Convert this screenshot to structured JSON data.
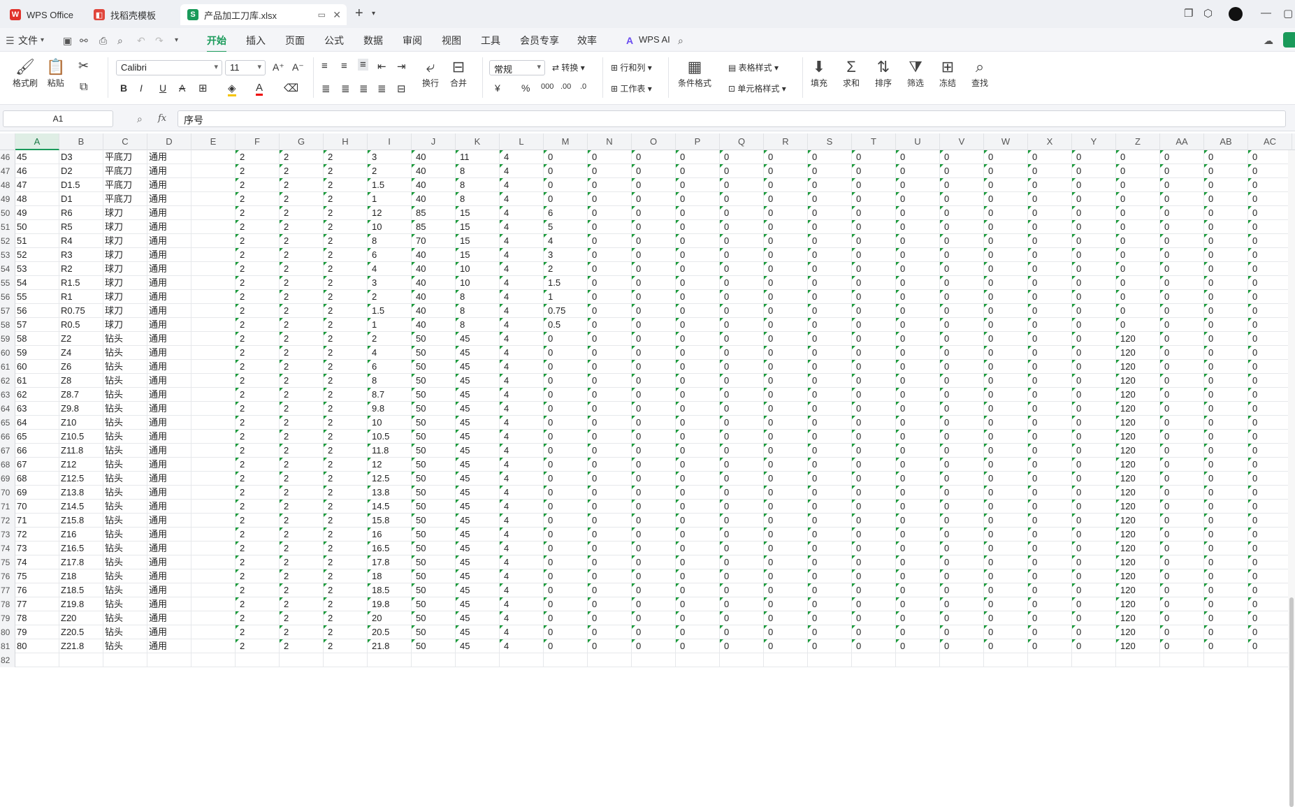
{
  "tabs": {
    "wps": "WPS Office",
    "template": "找稻壳模板",
    "file": "产品加工刀库.xlsx"
  },
  "menu": {
    "file": "文件",
    "items": [
      "开始",
      "插入",
      "页面",
      "公式",
      "数据",
      "审阅",
      "视图",
      "工具",
      "会员专享",
      "效率"
    ],
    "wpsai": "WPS AI"
  },
  "ribbon": {
    "format_painter": "格式刷",
    "paste": "粘贴",
    "font": "Calibri",
    "size": "11",
    "wrap": "换行",
    "merge": "合并",
    "numfmt": "常规",
    "convert": "转换",
    "rowcol": "行和列",
    "sheet": "工作表",
    "condfmt": "条件格式",
    "tablestyle": "表格样式",
    "cellstyle": "单元格样式",
    "fill": "填充",
    "sum": "求和",
    "sort": "排序",
    "filter": "筛选",
    "freeze": "冻结",
    "find": "查找"
  },
  "formula_bar": {
    "cell_ref": "A1",
    "fx": "fx",
    "content": "序号"
  },
  "columns": [
    "A",
    "B",
    "C",
    "D",
    "E",
    "F",
    "G",
    "H",
    "I",
    "J",
    "K",
    "L",
    "M",
    "N",
    "O",
    "P",
    "Q",
    "R",
    "S",
    "T",
    "U",
    "V",
    "W",
    "X",
    "Y",
    "Z",
    "AA",
    "AB",
    "AC"
  ],
  "rows": [
    {
      "r": "46",
      "c": [
        "45",
        "D3",
        "平底刀",
        "通用",
        "",
        "2",
        "2",
        "2",
        "3",
        "40",
        "11",
        "4",
        "0",
        "0",
        "0",
        "0",
        "0",
        "0",
        "0",
        "0",
        "0",
        "0",
        "0",
        "0",
        "0",
        "0",
        "0",
        "0",
        "0"
      ]
    },
    {
      "r": "47",
      "c": [
        "46",
        "D2",
        "平底刀",
        "通用",
        "",
        "2",
        "2",
        "2",
        "2",
        "40",
        "8",
        "4",
        "0",
        "0",
        "0",
        "0",
        "0",
        "0",
        "0",
        "0",
        "0",
        "0",
        "0",
        "0",
        "0",
        "0",
        "0",
        "0",
        "0"
      ]
    },
    {
      "r": "48",
      "c": [
        "47",
        "D1.5",
        "平底刀",
        "通用",
        "",
        "2",
        "2",
        "2",
        "1.5",
        "40",
        "8",
        "4",
        "0",
        "0",
        "0",
        "0",
        "0",
        "0",
        "0",
        "0",
        "0",
        "0",
        "0",
        "0",
        "0",
        "0",
        "0",
        "0",
        "0"
      ]
    },
    {
      "r": "49",
      "c": [
        "48",
        "D1",
        "平底刀",
        "通用",
        "",
        "2",
        "2",
        "2",
        "1",
        "40",
        "8",
        "4",
        "0",
        "0",
        "0",
        "0",
        "0",
        "0",
        "0",
        "0",
        "0",
        "0",
        "0",
        "0",
        "0",
        "0",
        "0",
        "0",
        "0"
      ]
    },
    {
      "r": "50",
      "c": [
        "49",
        "R6",
        "球刀",
        "通用",
        "",
        "2",
        "2",
        "2",
        "12",
        "85",
        "15",
        "4",
        "6",
        "0",
        "0",
        "0",
        "0",
        "0",
        "0",
        "0",
        "0",
        "0",
        "0",
        "0",
        "0",
        "0",
        "0",
        "0",
        "0"
      ]
    },
    {
      "r": "51",
      "c": [
        "50",
        "R5",
        "球刀",
        "通用",
        "",
        "2",
        "2",
        "2",
        "10",
        "85",
        "15",
        "4",
        "5",
        "0",
        "0",
        "0",
        "0",
        "0",
        "0",
        "0",
        "0",
        "0",
        "0",
        "0",
        "0",
        "0",
        "0",
        "0",
        "0"
      ]
    },
    {
      "r": "52",
      "c": [
        "51",
        "R4",
        "球刀",
        "通用",
        "",
        "2",
        "2",
        "2",
        "8",
        "70",
        "15",
        "4",
        "4",
        "0",
        "0",
        "0",
        "0",
        "0",
        "0",
        "0",
        "0",
        "0",
        "0",
        "0",
        "0",
        "0",
        "0",
        "0",
        "0"
      ]
    },
    {
      "r": "53",
      "c": [
        "52",
        "R3",
        "球刀",
        "通用",
        "",
        "2",
        "2",
        "2",
        "6",
        "40",
        "15",
        "4",
        "3",
        "0",
        "0",
        "0",
        "0",
        "0",
        "0",
        "0",
        "0",
        "0",
        "0",
        "0",
        "0",
        "0",
        "0",
        "0",
        "0"
      ]
    },
    {
      "r": "54",
      "c": [
        "53",
        "R2",
        "球刀",
        "通用",
        "",
        "2",
        "2",
        "2",
        "4",
        "40",
        "10",
        "4",
        "2",
        "0",
        "0",
        "0",
        "0",
        "0",
        "0",
        "0",
        "0",
        "0",
        "0",
        "0",
        "0",
        "0",
        "0",
        "0",
        "0"
      ]
    },
    {
      "r": "55",
      "c": [
        "54",
        "R1.5",
        "球刀",
        "通用",
        "",
        "2",
        "2",
        "2",
        "3",
        "40",
        "10",
        "4",
        "1.5",
        "0",
        "0",
        "0",
        "0",
        "0",
        "0",
        "0",
        "0",
        "0",
        "0",
        "0",
        "0",
        "0",
        "0",
        "0",
        "0"
      ]
    },
    {
      "r": "56",
      "c": [
        "55",
        "R1",
        "球刀",
        "通用",
        "",
        "2",
        "2",
        "2",
        "2",
        "40",
        "8",
        "4",
        "1",
        "0",
        "0",
        "0",
        "0",
        "0",
        "0",
        "0",
        "0",
        "0",
        "0",
        "0",
        "0",
        "0",
        "0",
        "0",
        "0"
      ]
    },
    {
      "r": "57",
      "c": [
        "56",
        "R0.75",
        "球刀",
        "通用",
        "",
        "2",
        "2",
        "2",
        "1.5",
        "40",
        "8",
        "4",
        "0.75",
        "0",
        "0",
        "0",
        "0",
        "0",
        "0",
        "0",
        "0",
        "0",
        "0",
        "0",
        "0",
        "0",
        "0",
        "0",
        "0"
      ]
    },
    {
      "r": "58",
      "c": [
        "57",
        "R0.5",
        "球刀",
        "通用",
        "",
        "2",
        "2",
        "2",
        "1",
        "40",
        "8",
        "4",
        "0.5",
        "0",
        "0",
        "0",
        "0",
        "0",
        "0",
        "0",
        "0",
        "0",
        "0",
        "0",
        "0",
        "0",
        "0",
        "0",
        "0"
      ]
    },
    {
      "r": "59",
      "c": [
        "58",
        "Z2",
        "钻头",
        "通用",
        "",
        "2",
        "2",
        "2",
        "2",
        "50",
        "45",
        "4",
        "0",
        "0",
        "0",
        "0",
        "0",
        "0",
        "0",
        "0",
        "0",
        "0",
        "0",
        "0",
        "0",
        "120",
        "0",
        "0",
        "0"
      ]
    },
    {
      "r": "60",
      "c": [
        "59",
        "Z4",
        "钻头",
        "通用",
        "",
        "2",
        "2",
        "2",
        "4",
        "50",
        "45",
        "4",
        "0",
        "0",
        "0",
        "0",
        "0",
        "0",
        "0",
        "0",
        "0",
        "0",
        "0",
        "0",
        "0",
        "120",
        "0",
        "0",
        "0"
      ]
    },
    {
      "r": "61",
      "c": [
        "60",
        "Z6",
        "钻头",
        "通用",
        "",
        "2",
        "2",
        "2",
        "6",
        "50",
        "45",
        "4",
        "0",
        "0",
        "0",
        "0",
        "0",
        "0",
        "0",
        "0",
        "0",
        "0",
        "0",
        "0",
        "0",
        "120",
        "0",
        "0",
        "0"
      ]
    },
    {
      "r": "62",
      "c": [
        "61",
        "Z8",
        "钻头",
        "通用",
        "",
        "2",
        "2",
        "2",
        "8",
        "50",
        "45",
        "4",
        "0",
        "0",
        "0",
        "0",
        "0",
        "0",
        "0",
        "0",
        "0",
        "0",
        "0",
        "0",
        "0",
        "120",
        "0",
        "0",
        "0"
      ]
    },
    {
      "r": "63",
      "c": [
        "62",
        "Z8.7",
        "钻头",
        "通用",
        "",
        "2",
        "2",
        "2",
        "8.7",
        "50",
        "45",
        "4",
        "0",
        "0",
        "0",
        "0",
        "0",
        "0",
        "0",
        "0",
        "0",
        "0",
        "0",
        "0",
        "0",
        "120",
        "0",
        "0",
        "0"
      ]
    },
    {
      "r": "64",
      "c": [
        "63",
        "Z9.8",
        "钻头",
        "通用",
        "",
        "2",
        "2",
        "2",
        "9.8",
        "50",
        "45",
        "4",
        "0",
        "0",
        "0",
        "0",
        "0",
        "0",
        "0",
        "0",
        "0",
        "0",
        "0",
        "0",
        "0",
        "120",
        "0",
        "0",
        "0"
      ]
    },
    {
      "r": "65",
      "c": [
        "64",
        "Z10",
        "钻头",
        "通用",
        "",
        "2",
        "2",
        "2",
        "10",
        "50",
        "45",
        "4",
        "0",
        "0",
        "0",
        "0",
        "0",
        "0",
        "0",
        "0",
        "0",
        "0",
        "0",
        "0",
        "0",
        "120",
        "0",
        "0",
        "0"
      ]
    },
    {
      "r": "66",
      "c": [
        "65",
        "Z10.5",
        "钻头",
        "通用",
        "",
        "2",
        "2",
        "2",
        "10.5",
        "50",
        "45",
        "4",
        "0",
        "0",
        "0",
        "0",
        "0",
        "0",
        "0",
        "0",
        "0",
        "0",
        "0",
        "0",
        "0",
        "120",
        "0",
        "0",
        "0"
      ]
    },
    {
      "r": "67",
      "c": [
        "66",
        "Z11.8",
        "钻头",
        "通用",
        "",
        "2",
        "2",
        "2",
        "11.8",
        "50",
        "45",
        "4",
        "0",
        "0",
        "0",
        "0",
        "0",
        "0",
        "0",
        "0",
        "0",
        "0",
        "0",
        "0",
        "0",
        "120",
        "0",
        "0",
        "0"
      ]
    },
    {
      "r": "68",
      "c": [
        "67",
        "Z12",
        "钻头",
        "通用",
        "",
        "2",
        "2",
        "2",
        "12",
        "50",
        "45",
        "4",
        "0",
        "0",
        "0",
        "0",
        "0",
        "0",
        "0",
        "0",
        "0",
        "0",
        "0",
        "0",
        "0",
        "120",
        "0",
        "0",
        "0"
      ]
    },
    {
      "r": "69",
      "c": [
        "68",
        "Z12.5",
        "钻头",
        "通用",
        "",
        "2",
        "2",
        "2",
        "12.5",
        "50",
        "45",
        "4",
        "0",
        "0",
        "0",
        "0",
        "0",
        "0",
        "0",
        "0",
        "0",
        "0",
        "0",
        "0",
        "0",
        "120",
        "0",
        "0",
        "0"
      ]
    },
    {
      "r": "70",
      "c": [
        "69",
        "Z13.8",
        "钻头",
        "通用",
        "",
        "2",
        "2",
        "2",
        "13.8",
        "50",
        "45",
        "4",
        "0",
        "0",
        "0",
        "0",
        "0",
        "0",
        "0",
        "0",
        "0",
        "0",
        "0",
        "0",
        "0",
        "120",
        "0",
        "0",
        "0"
      ]
    },
    {
      "r": "71",
      "c": [
        "70",
        "Z14.5",
        "钻头",
        "通用",
        "",
        "2",
        "2",
        "2",
        "14.5",
        "50",
        "45",
        "4",
        "0",
        "0",
        "0",
        "0",
        "0",
        "0",
        "0",
        "0",
        "0",
        "0",
        "0",
        "0",
        "0",
        "120",
        "0",
        "0",
        "0"
      ]
    },
    {
      "r": "72",
      "c": [
        "71",
        "Z15.8",
        "钻头",
        "通用",
        "",
        "2",
        "2",
        "2",
        "15.8",
        "50",
        "45",
        "4",
        "0",
        "0",
        "0",
        "0",
        "0",
        "0",
        "0",
        "0",
        "0",
        "0",
        "0",
        "0",
        "0",
        "120",
        "0",
        "0",
        "0"
      ]
    },
    {
      "r": "73",
      "c": [
        "72",
        "Z16",
        "钻头",
        "通用",
        "",
        "2",
        "2",
        "2",
        "16",
        "50",
        "45",
        "4",
        "0",
        "0",
        "0",
        "0",
        "0",
        "0",
        "0",
        "0",
        "0",
        "0",
        "0",
        "0",
        "0",
        "120",
        "0",
        "0",
        "0"
      ]
    },
    {
      "r": "74",
      "c": [
        "73",
        "Z16.5",
        "钻头",
        "通用",
        "",
        "2",
        "2",
        "2",
        "16.5",
        "50",
        "45",
        "4",
        "0",
        "0",
        "0",
        "0",
        "0",
        "0",
        "0",
        "0",
        "0",
        "0",
        "0",
        "0",
        "0",
        "120",
        "0",
        "0",
        "0"
      ]
    },
    {
      "r": "75",
      "c": [
        "74",
        "Z17.8",
        "钻头",
        "通用",
        "",
        "2",
        "2",
        "2",
        "17.8",
        "50",
        "45",
        "4",
        "0",
        "0",
        "0",
        "0",
        "0",
        "0",
        "0",
        "0",
        "0",
        "0",
        "0",
        "0",
        "0",
        "120",
        "0",
        "0",
        "0"
      ]
    },
    {
      "r": "76",
      "c": [
        "75",
        "Z18",
        "钻头",
        "通用",
        "",
        "2",
        "2",
        "2",
        "18",
        "50",
        "45",
        "4",
        "0",
        "0",
        "0",
        "0",
        "0",
        "0",
        "0",
        "0",
        "0",
        "0",
        "0",
        "0",
        "0",
        "120",
        "0",
        "0",
        "0"
      ]
    },
    {
      "r": "77",
      "c": [
        "76",
        "Z18.5",
        "钻头",
        "通用",
        "",
        "2",
        "2",
        "2",
        "18.5",
        "50",
        "45",
        "4",
        "0",
        "0",
        "0",
        "0",
        "0",
        "0",
        "0",
        "0",
        "0",
        "0",
        "0",
        "0",
        "0",
        "120",
        "0",
        "0",
        "0"
      ]
    },
    {
      "r": "78",
      "c": [
        "77",
        "Z19.8",
        "钻头",
        "通用",
        "",
        "2",
        "2",
        "2",
        "19.8",
        "50",
        "45",
        "4",
        "0",
        "0",
        "0",
        "0",
        "0",
        "0",
        "0",
        "0",
        "0",
        "0",
        "0",
        "0",
        "0",
        "120",
        "0",
        "0",
        "0"
      ]
    },
    {
      "r": "79",
      "c": [
        "78",
        "Z20",
        "钻头",
        "通用",
        "",
        "2",
        "2",
        "2",
        "20",
        "50",
        "45",
        "4",
        "0",
        "0",
        "0",
        "0",
        "0",
        "0",
        "0",
        "0",
        "0",
        "0",
        "0",
        "0",
        "0",
        "120",
        "0",
        "0",
        "0"
      ]
    },
    {
      "r": "80",
      "c": [
        "79",
        "Z20.5",
        "钻头",
        "通用",
        "",
        "2",
        "2",
        "2",
        "20.5",
        "50",
        "45",
        "4",
        "0",
        "0",
        "0",
        "0",
        "0",
        "0",
        "0",
        "0",
        "0",
        "0",
        "0",
        "0",
        "0",
        "120",
        "0",
        "0",
        "0"
      ]
    },
    {
      "r": "81",
      "c": [
        "80",
        "Z21.8",
        "钻头",
        "通用",
        "",
        "2",
        "2",
        "2",
        "21.8",
        "50",
        "45",
        "4",
        "0",
        "0",
        "0",
        "0",
        "0",
        "0",
        "0",
        "0",
        "0",
        "0",
        "0",
        "0",
        "0",
        "120",
        "0",
        "0",
        "0"
      ]
    },
    {
      "r": "82",
      "c": [
        "",
        "",
        "",
        "",
        "",
        "",
        "",
        "",
        "",
        "",
        "",
        "",
        "",
        "",
        "",
        "",
        "",
        "",
        "",
        "",
        "",
        "",
        "",
        "",
        "",
        "",
        "",
        "",
        ""
      ]
    }
  ],
  "colors": {
    "accent": "#1a9a5a",
    "error_marker": "#1a9a3a"
  }
}
